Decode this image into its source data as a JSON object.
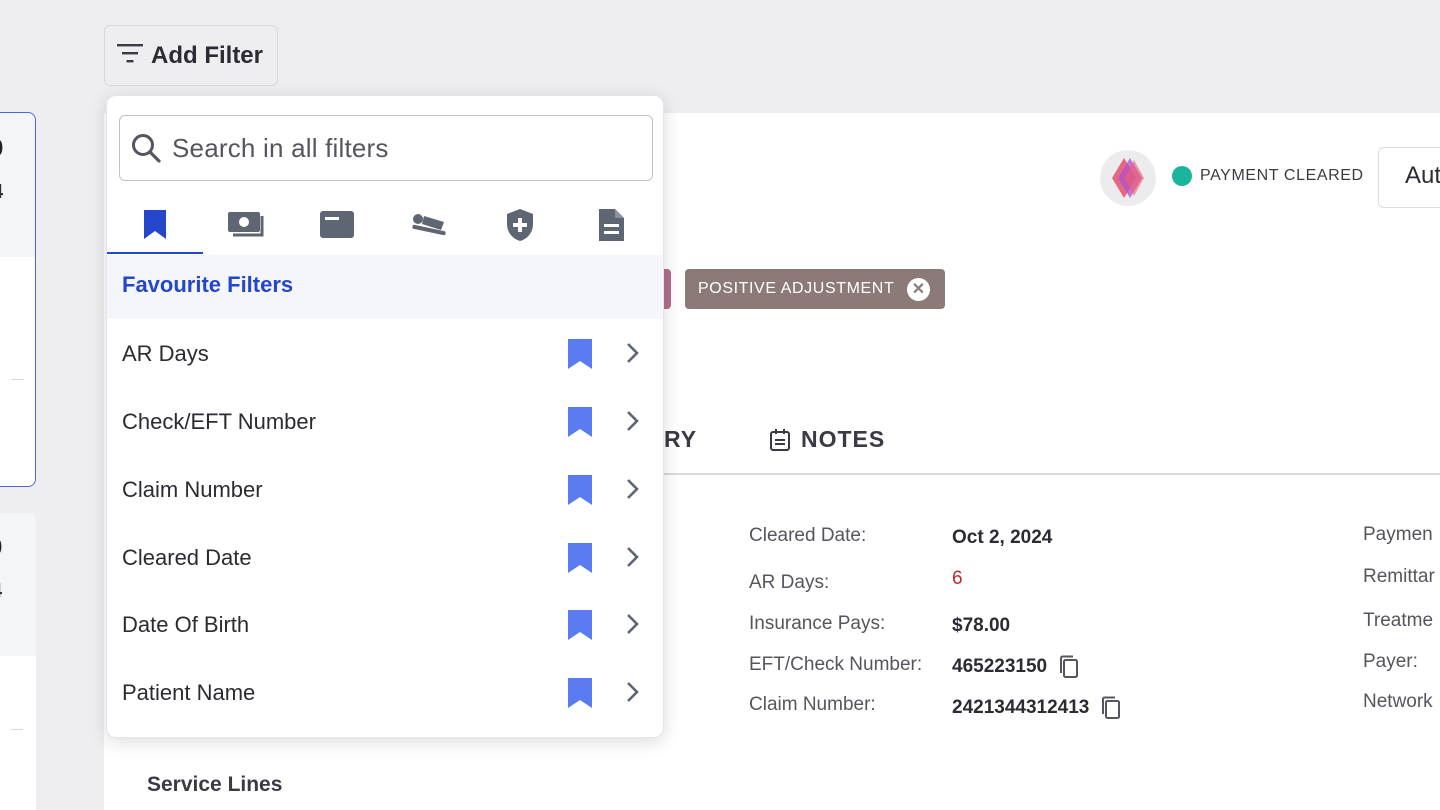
{
  "left_cards": [
    {
      "num": "0",
      "sub": "4"
    },
    {
      "num": "0",
      "sub": "4"
    }
  ],
  "toolbar": {
    "add_filter_label": "Add Filter"
  },
  "header": {
    "status": "PAYMENT CLEARED",
    "status_color": "#19b69b",
    "auto_button": "Aut"
  },
  "chips": {
    "positive_adjustment": "POSITIVE ADJUSTMENT"
  },
  "tabs": {
    "history_partial": "RY",
    "notes": "NOTES"
  },
  "details": {
    "cleared_date": {
      "label": "Cleared Date:",
      "value": "Oct 2, 2024"
    },
    "ar_days": {
      "label": "AR Days:",
      "value": "6"
    },
    "insurance_pays": {
      "label": "Insurance Pays:",
      "value": "$78.00"
    },
    "eft_check": {
      "label": "EFT/Check Number:",
      "value": "465223150"
    },
    "claim_number": {
      "label": "Claim Number:",
      "value": "2421344312413"
    }
  },
  "right_labels": [
    "Paymen",
    "Remittar",
    "Treatme",
    "Payer:",
    "Network"
  ],
  "service_lines": "Service Lines",
  "dropdown": {
    "search_placeholder": "Search in all filters",
    "category_tabs": [
      "bookmark-icon",
      "money-icon",
      "card-icon",
      "patient-icon",
      "shield-plus-icon",
      "document-icon"
    ],
    "section_title": "Favourite Filters",
    "items": [
      {
        "label": "AR Days"
      },
      {
        "label": "Check/EFT Number"
      },
      {
        "label": "Claim Number"
      },
      {
        "label": "Cleared Date"
      },
      {
        "label": "Date Of Birth"
      },
      {
        "label": "Patient Name"
      }
    ]
  },
  "colors": {
    "accent": "#2446c9",
    "bookmark": "#5b7bf0",
    "chip": "#8c7a78"
  }
}
